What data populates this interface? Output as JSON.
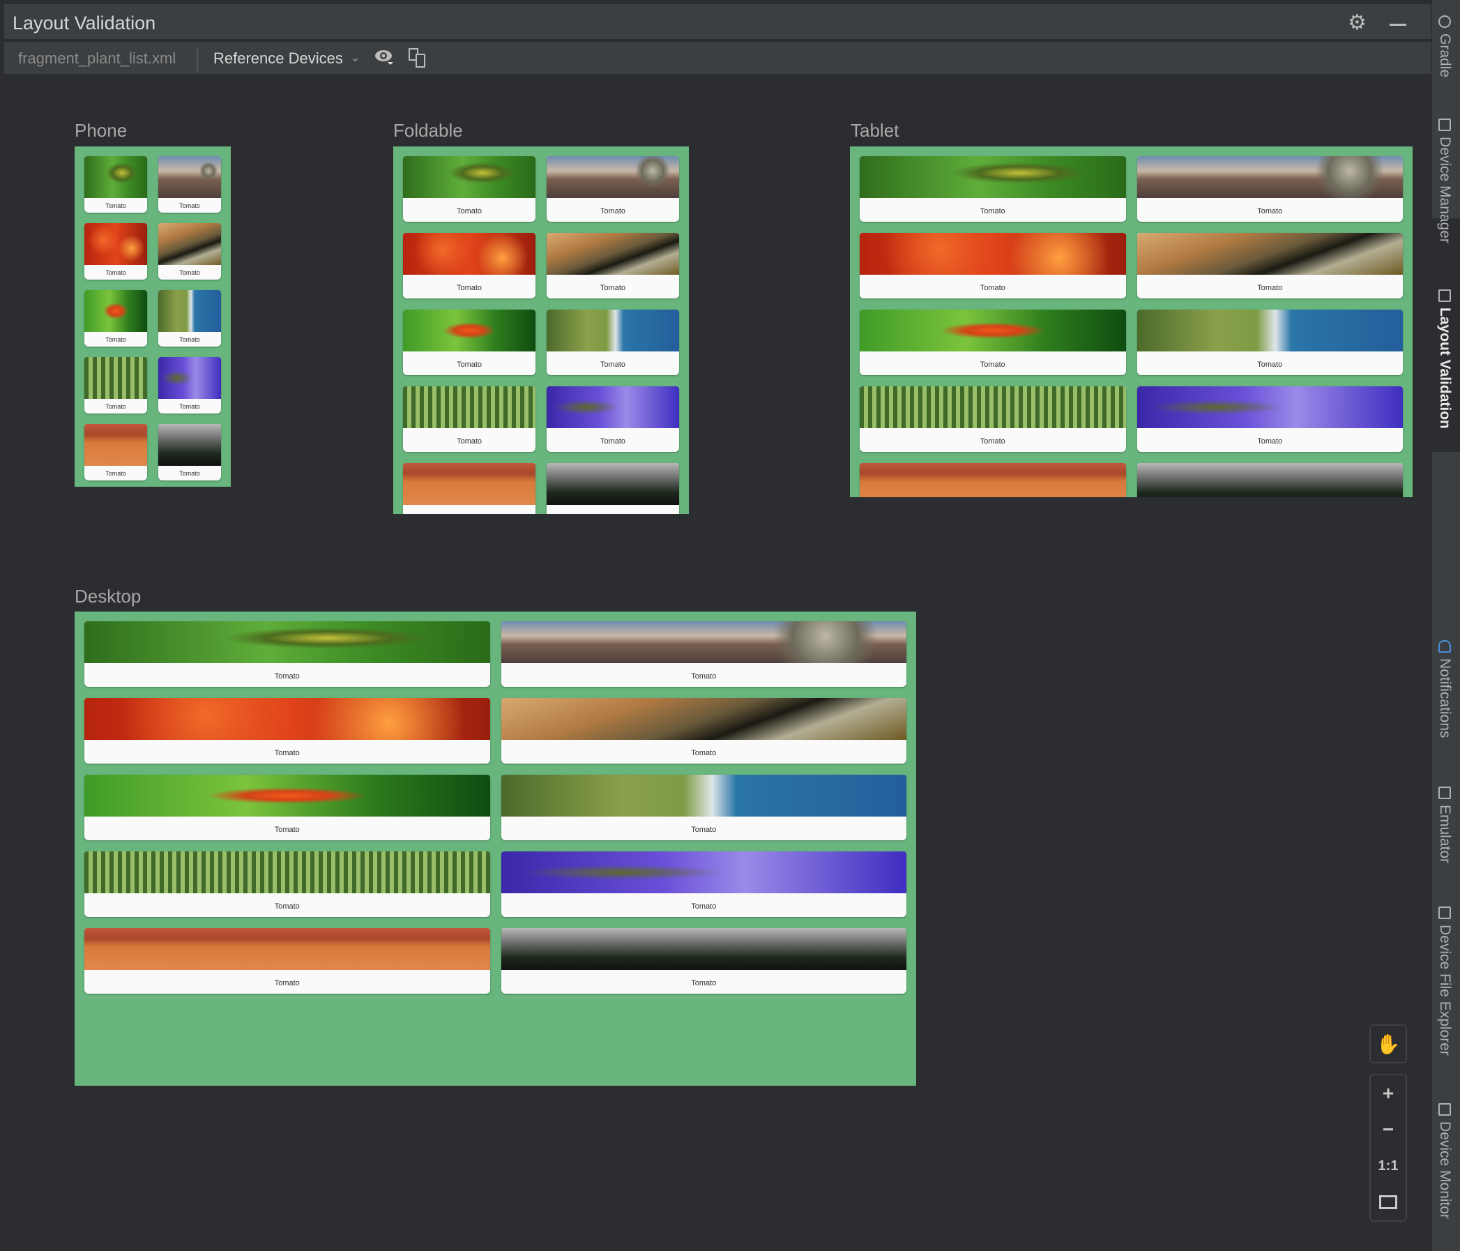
{
  "window": {
    "title": "Layout Validation"
  },
  "toolbar": {
    "file": "fragment_plant_list.xml",
    "devices": "Reference Devices"
  },
  "devices": [
    {
      "label": "Phone",
      "key": "phone"
    },
    {
      "label": "Foldable",
      "key": "foldable"
    },
    {
      "label": "Tablet",
      "key": "tablet"
    },
    {
      "label": "Desktop",
      "key": "desktop"
    }
  ],
  "plants": [
    {
      "name": "Tomato",
      "image": "caterpillar"
    },
    {
      "name": "Tomato",
      "image": "telescope"
    },
    {
      "name": "Tomato",
      "image": "maple"
    },
    {
      "name": "Tomato",
      "image": "wood"
    },
    {
      "name": "Tomato",
      "image": "leaf"
    },
    {
      "name": "Tomato",
      "image": "coast"
    },
    {
      "name": "Tomato",
      "image": "orchard"
    },
    {
      "name": "Tomato",
      "image": "water"
    },
    {
      "name": "Tomato",
      "image": "desert"
    },
    {
      "name": "Tomato",
      "image": "forest"
    }
  ],
  "side_panel": {
    "items": [
      "Gradle",
      "Device Manager",
      "Layout Validation",
      "Notifications",
      "Emulator",
      "Device File Explorer",
      "Device Monitor"
    ],
    "active": "Layout Validation"
  },
  "zoom_controls": {
    "actual_size": "1:1"
  },
  "colors": {
    "preview_background": "#68b57d",
    "card": "#fafafa",
    "ide_background": "#2b2d30"
  }
}
